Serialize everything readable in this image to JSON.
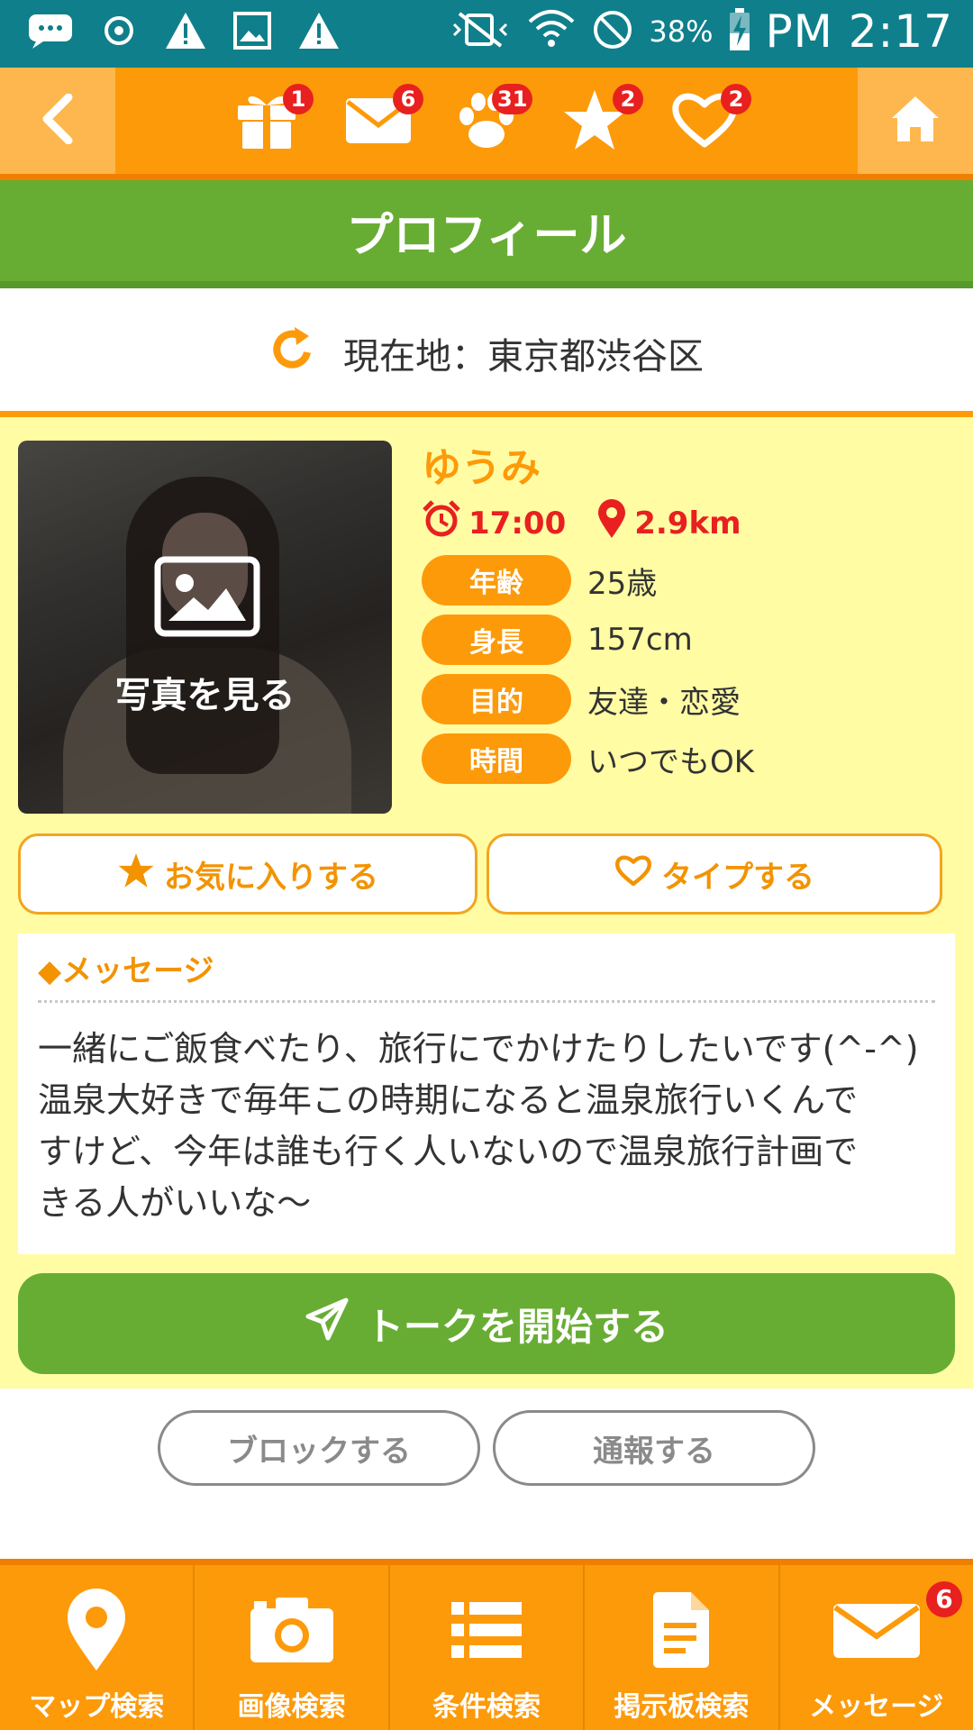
{
  "status_bar": {
    "battery": "38%",
    "time": "PM 2:17"
  },
  "top_nav": {
    "badges": {
      "gift": "1",
      "mail": "6",
      "paw": "31",
      "star": "2",
      "heart": "2"
    }
  },
  "title": "プロフィール",
  "location": "現在地：東京都渋谷区",
  "profile": {
    "photo_label": "写真を見る",
    "name": "ゆうみ",
    "time": "17:00",
    "distance": "2.9km",
    "fields": [
      {
        "label": "年齢",
        "value": "25歳"
      },
      {
        "label": "身長",
        "value": "157cm"
      },
      {
        "label": "目的",
        "value": "友達・恋愛"
      },
      {
        "label": "時間",
        "value": "いつでもOK"
      }
    ],
    "favorite_label": "お気に入りする",
    "type_label": "タイプする"
  },
  "message": {
    "title": "◆メッセージ",
    "body": "一緒にご飯食べたり、旅行にでかけたりしたいです(^-^)\n温泉大好きで毎年この時期になると温泉旅行いくんで\nすけど、今年は誰も行く人いないので温泉旅行計画で\nきる人がいいな～"
  },
  "talk_button": "トークを開始する",
  "block_button": "ブロックする",
  "report_button": "通報する",
  "tabs": [
    {
      "label": "マップ検索"
    },
    {
      "label": "画像検索"
    },
    {
      "label": "条件検索"
    },
    {
      "label": "掲示板検索"
    },
    {
      "label": "メッセージ",
      "badge": "6"
    }
  ],
  "colors": {
    "accent_orange": "#fd9a0a",
    "green": "#68ad33",
    "yellow_bg": "#fffca4",
    "badge_red": "#e8201f",
    "status_teal": "#0f7f8b"
  }
}
